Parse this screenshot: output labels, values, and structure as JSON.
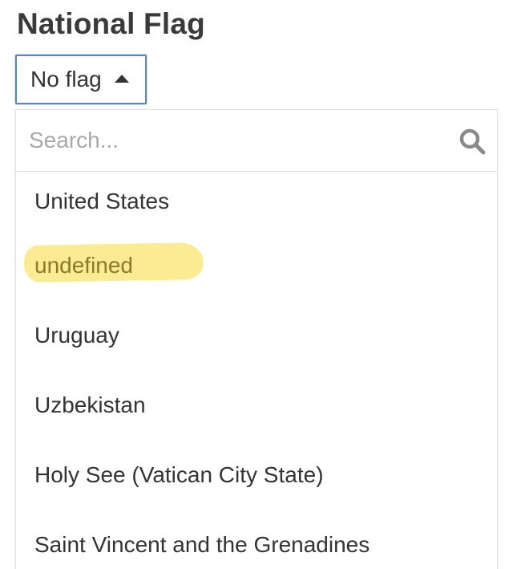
{
  "header": {
    "title": "National Flag"
  },
  "select": {
    "value": "No flag",
    "caret_icon": "caret-up-icon"
  },
  "dropdown": {
    "search": {
      "placeholder": "Search...",
      "value": "",
      "icon": "search-icon"
    },
    "options": [
      {
        "label": "United States"
      },
      {
        "label": "undefined",
        "highlighted": true
      },
      {
        "label": "Uruguay"
      },
      {
        "label": "Uzbekistan"
      },
      {
        "label": "Holy See (Vatican City State)"
      },
      {
        "label": "Saint Vincent and the Grenadines"
      }
    ]
  },
  "colors": {
    "accent_border": "#5b88b8",
    "highlight": "#fbe986",
    "text": "#333333",
    "placeholder": "#a8a8a8"
  }
}
